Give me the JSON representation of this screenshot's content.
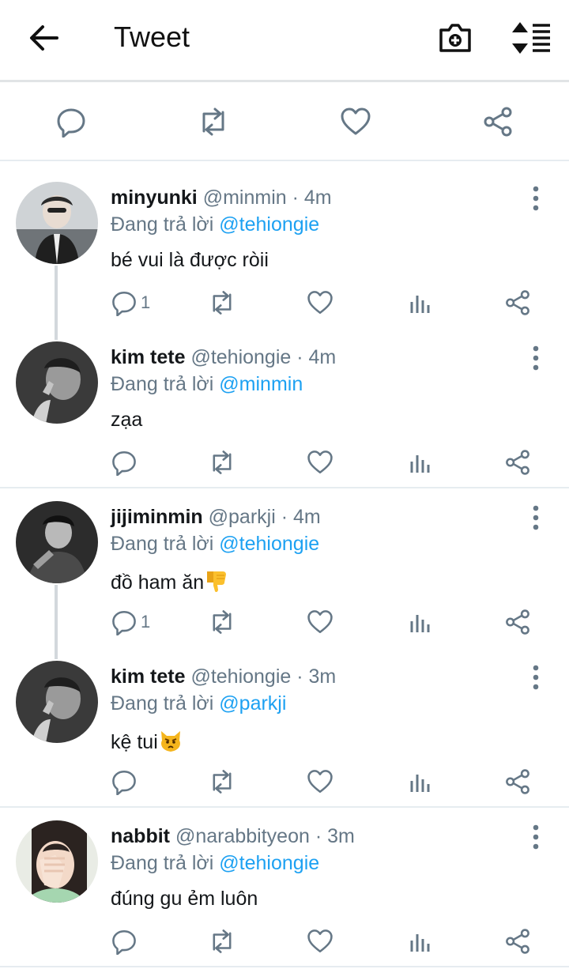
{
  "header": {
    "title": "Tweet"
  },
  "reply_prefix": "Đang trả lời",
  "tweets": [
    {
      "name": "minyunki",
      "handle": "@minmin",
      "time": "· 4m",
      "reply_to": "@tehiongie",
      "text": "bé vui là được ròii",
      "reply_count": "1"
    },
    {
      "name": "kim tete",
      "handle": "@tehiongie",
      "time": "· 4m",
      "reply_to": "@minmin",
      "text": "zạa",
      "reply_count": ""
    },
    {
      "name": "jijiminmin",
      "handle": "@parkji",
      "time": "· 4m",
      "reply_to": "@tehiongie",
      "text": "đồ ham ăn",
      "reply_count": "1"
    },
    {
      "name": "kim tete",
      "handle": "@tehiongie",
      "time": "· 3m",
      "reply_to": "@parkji",
      "text": "kệ tui",
      "reply_count": ""
    },
    {
      "name": "nabbit",
      "handle": "@narabbityeon",
      "time": "· 3m",
      "reply_to": "@tehiongie",
      "text": "đúng gu ẻm luôn",
      "reply_count": ""
    }
  ],
  "colors": {
    "accent": "#1da1f2",
    "icon": "#657786",
    "text": "#14171a"
  }
}
